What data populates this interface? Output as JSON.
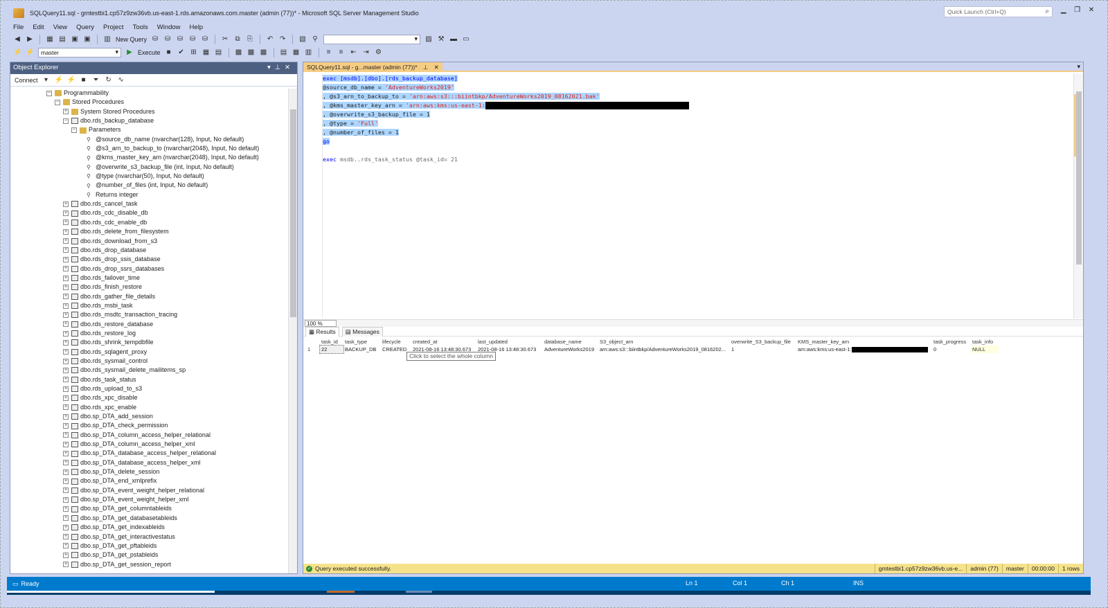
{
  "window": {
    "title": "SQLQuery11.sql - gmtestbi1.cp57z9zw36vb.us-east-1.rds.amazonaws.com.master (admin (77))* - Microsoft SQL Server Management Studio",
    "quick_launch_placeholder": "Quick Launch (Ctrl+Q)"
  },
  "menu": [
    "File",
    "Edit",
    "View",
    "Query",
    "Project",
    "Tools",
    "Window",
    "Help"
  ],
  "toolbar": {
    "new_query": "New Query",
    "database": "master",
    "execute": "Execute"
  },
  "object_explorer": {
    "title": "Object Explorer",
    "connect": "Connect",
    "tree": [
      {
        "indent": 52,
        "exp": "⊟",
        "icon": "folder",
        "label": "Programmability"
      },
      {
        "indent": 64,
        "exp": "⊟",
        "icon": "folder",
        "label": "Stored Procedures"
      },
      {
        "indent": 76,
        "exp": "⊞",
        "icon": "folder",
        "label": "System Stored Procedures"
      },
      {
        "indent": 76,
        "exp": "⊟",
        "icon": "proc",
        "label": "dbo.rds_backup_database"
      },
      {
        "indent": 88,
        "exp": "⊟",
        "icon": "folder",
        "label": "Parameters"
      },
      {
        "indent": 110,
        "exp": "",
        "icon": "param",
        "label": "@source_db_name (nvarchar(128), Input, No default)"
      },
      {
        "indent": 110,
        "exp": "",
        "icon": "param",
        "label": "@s3_arn_to_backup_to (nvarchar(2048), Input, No default)"
      },
      {
        "indent": 110,
        "exp": "",
        "icon": "param",
        "label": "@kms_master_key_arn (nvarchar(2048), Input, No default)"
      },
      {
        "indent": 110,
        "exp": "",
        "icon": "param",
        "label": "@overwrite_s3_backup_file (int, Input, No default)"
      },
      {
        "indent": 110,
        "exp": "",
        "icon": "param",
        "label": "@type (nvarchar(50), Input, No default)"
      },
      {
        "indent": 110,
        "exp": "",
        "icon": "param",
        "label": "@number_of_files (int, Input, No default)"
      },
      {
        "indent": 110,
        "exp": "",
        "icon": "param",
        "label": "Returns integer"
      },
      {
        "indent": 76,
        "exp": "⊞",
        "icon": "proc",
        "label": "dbo.rds_cancel_task"
      },
      {
        "indent": 76,
        "exp": "⊞",
        "icon": "proc",
        "label": "dbo.rds_cdc_disable_db"
      },
      {
        "indent": 76,
        "exp": "⊞",
        "icon": "proc",
        "label": "dbo.rds_cdc_enable_db"
      },
      {
        "indent": 76,
        "exp": "⊞",
        "icon": "proc",
        "label": "dbo.rds_delete_from_filesystem"
      },
      {
        "indent": 76,
        "exp": "⊞",
        "icon": "proc",
        "label": "dbo.rds_download_from_s3"
      },
      {
        "indent": 76,
        "exp": "⊞",
        "icon": "proc",
        "label": "dbo.rds_drop_database"
      },
      {
        "indent": 76,
        "exp": "⊞",
        "icon": "proc",
        "label": "dbo.rds_drop_ssis_database"
      },
      {
        "indent": 76,
        "exp": "⊞",
        "icon": "proc",
        "label": "dbo.rds_drop_ssrs_databases"
      },
      {
        "indent": 76,
        "exp": "⊞",
        "icon": "proc",
        "label": "dbo.rds_failover_time"
      },
      {
        "indent": 76,
        "exp": "⊞",
        "icon": "proc",
        "label": "dbo.rds_finish_restore"
      },
      {
        "indent": 76,
        "exp": "⊞",
        "icon": "proc",
        "label": "dbo.rds_gather_file_details"
      },
      {
        "indent": 76,
        "exp": "⊞",
        "icon": "proc",
        "label": "dbo.rds_msbi_task"
      },
      {
        "indent": 76,
        "exp": "⊞",
        "icon": "proc",
        "label": "dbo.rds_msdtc_transaction_tracing"
      },
      {
        "indent": 76,
        "exp": "⊞",
        "icon": "proc",
        "label": "dbo.rds_restore_database"
      },
      {
        "indent": 76,
        "exp": "⊞",
        "icon": "proc",
        "label": "dbo.rds_restore_log"
      },
      {
        "indent": 76,
        "exp": "⊞",
        "icon": "proc",
        "label": "dbo.rds_shrink_tempdbfile"
      },
      {
        "indent": 76,
        "exp": "⊞",
        "icon": "proc",
        "label": "dbo.rds_sqlagent_proxy"
      },
      {
        "indent": 76,
        "exp": "⊞",
        "icon": "proc",
        "label": "dbo.rds_sysmail_control"
      },
      {
        "indent": 76,
        "exp": "⊞",
        "icon": "proc",
        "label": "dbo.rds_sysmail_delete_mailitems_sp"
      },
      {
        "indent": 76,
        "exp": "⊞",
        "icon": "proc",
        "label": "dbo.rds_task_status"
      },
      {
        "indent": 76,
        "exp": "⊞",
        "icon": "proc",
        "label": "dbo.rds_upload_to_s3"
      },
      {
        "indent": 76,
        "exp": "⊞",
        "icon": "proc",
        "label": "dbo.rds_xpc_disable"
      },
      {
        "indent": 76,
        "exp": "⊞",
        "icon": "proc",
        "label": "dbo.rds_xpc_enable"
      },
      {
        "indent": 76,
        "exp": "⊞",
        "icon": "proc",
        "label": "dbo.sp_DTA_add_session"
      },
      {
        "indent": 76,
        "exp": "⊞",
        "icon": "proc",
        "label": "dbo.sp_DTA_check_permission"
      },
      {
        "indent": 76,
        "exp": "⊞",
        "icon": "proc",
        "label": "dbo.sp_DTA_column_access_helper_relational"
      },
      {
        "indent": 76,
        "exp": "⊞",
        "icon": "proc",
        "label": "dbo.sp_DTA_column_access_helper_xml"
      },
      {
        "indent": 76,
        "exp": "⊞",
        "icon": "proc",
        "label": "dbo.sp_DTA_database_access_helper_relational"
      },
      {
        "indent": 76,
        "exp": "⊞",
        "icon": "proc",
        "label": "dbo.sp_DTA_database_access_helper_xml"
      },
      {
        "indent": 76,
        "exp": "⊞",
        "icon": "proc",
        "label": "dbo.sp_DTA_delete_session"
      },
      {
        "indent": 76,
        "exp": "⊞",
        "icon": "proc",
        "label": "dbo.sp_DTA_end_xmlprefix"
      },
      {
        "indent": 76,
        "exp": "⊞",
        "icon": "proc",
        "label": "dbo.sp_DTA_event_weight_helper_relational"
      },
      {
        "indent": 76,
        "exp": "⊞",
        "icon": "proc",
        "label": "dbo.sp_DTA_event_weight_helper_xml"
      },
      {
        "indent": 76,
        "exp": "⊞",
        "icon": "proc",
        "label": "dbo.sp_DTA_get_columntableids"
      },
      {
        "indent": 76,
        "exp": "⊞",
        "icon": "proc",
        "label": "dbo.sp_DTA_get_databasetableids"
      },
      {
        "indent": 76,
        "exp": "⊞",
        "icon": "proc",
        "label": "dbo.sp_DTA_get_indexableids"
      },
      {
        "indent": 76,
        "exp": "⊞",
        "icon": "proc",
        "label": "dbo.sp_DTA_get_interactivestatus"
      },
      {
        "indent": 76,
        "exp": "⊞",
        "icon": "proc",
        "label": "dbo.sp_DTA_get_pftableids"
      },
      {
        "indent": 76,
        "exp": "⊞",
        "icon": "proc",
        "label": "dbo.sp_DTA_get_pstableids"
      },
      {
        "indent": 76,
        "exp": "⊞",
        "icon": "proc",
        "label": "dbo.sp_DTA_get_session_report"
      }
    ]
  },
  "editor": {
    "tab_label": "SQLQuery11.sql - g...master (admin (77))*",
    "zoom": "100 %",
    "lines": {
      "l1": "exec [msdb].[dbo].[rds_backup_database]",
      "l2a": "@source_db_name = ",
      "l2b": "'AdventureWorks2019'",
      "l3a": ", @s3_arn_to_backup_to = ",
      "l3b": "'arn:aws:s3:::biintbkp/AdventureWorks2019_08162021.bak'",
      "l4a": ", @kms_master_key_arn = ",
      "l4b": "'arn:aws:kms:us-east-1:",
      "l5": ", @overwrite_s3_backup_file = 1",
      "l6a": ", @type = ",
      "l6b": "'Full'",
      "l7": ", @number_of_files = 1",
      "l8": "go",
      "l10a": "exec ",
      "l10b": "msdb..rds_task_status @task_id= 21"
    }
  },
  "results": {
    "tab_results": "Results",
    "tab_messages": "Messages",
    "columns": [
      "task_id",
      "task_type",
      "lifecycle",
      "created_at",
      "last_updated",
      "database_name",
      "S3_object_arn",
      "overwrite_S3_backup_file",
      "KMS_master_key_arn",
      "task_progress",
      "task_info"
    ],
    "row_number": "1",
    "row": [
      "22",
      "BACKUP_DB",
      "CREATED",
      "2021-08-16 13:48:30.673",
      "2021-08-16 13:48:30.673",
      "AdventureWorks2019",
      "arn:aws:s3:::biintbkp/AdventureWorks2019_0816202...",
      "1",
      "arn:aws:kms:us-east-1:",
      "0",
      "NULL"
    ],
    "tooltip": "Click to select the whole column"
  },
  "query_status": {
    "message": "Query executed successfully.",
    "server": "gmtestbi1.cp57z9zw36vb.us-e...",
    "user": "admin (77)",
    "database": "master",
    "elapsed": "00:00:00",
    "rows": "1 rows"
  },
  "statusbar": {
    "ready": "Ready",
    "ln": "Ln 1",
    "col": "Col 1",
    "ch": "Ch 1",
    "ins": "INS"
  },
  "colors": {
    "accent": "#007acc",
    "tab_active": "#f5cc84",
    "selection": "#add6ff",
    "keyword": "#0000ff",
    "string": "#e0201a"
  }
}
